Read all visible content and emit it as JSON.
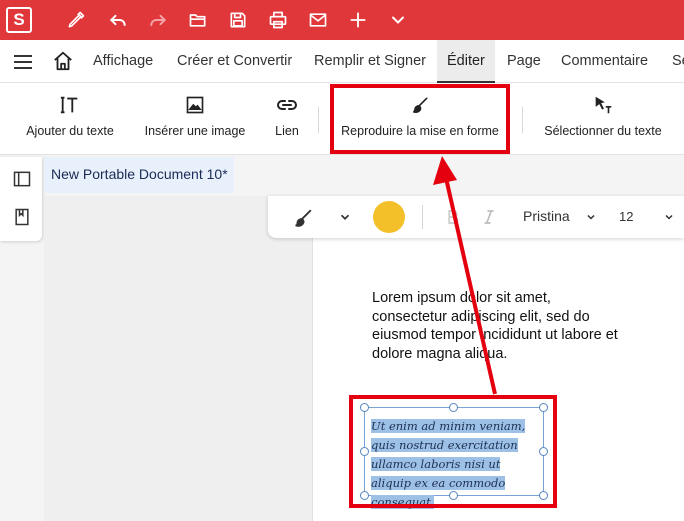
{
  "app": {
    "logo_letter": "S"
  },
  "quick_toolbar": [
    "sign-pen-icon",
    "undo-icon",
    "redo-icon",
    "open-folder-icon",
    "save-icon",
    "print-icon",
    "mail-icon",
    "plus-icon",
    "chevron-down-icon"
  ],
  "menu": {
    "items": [
      {
        "label": "Affichage"
      },
      {
        "label": "Créer et Convertir"
      },
      {
        "label": "Remplir et Signer"
      },
      {
        "label": "Éditer",
        "active": true
      },
      {
        "label": "Page"
      },
      {
        "label": "Commentaire"
      },
      {
        "label": "Se"
      }
    ]
  },
  "ribbon": {
    "add_text": "Ajouter du texte",
    "insert_image": "Insérer une image",
    "link": "Lien",
    "format_painter": "Reproduire la mise en forme",
    "select_text": "Sélectionner du texte"
  },
  "document": {
    "tab_title": "New Portable Document 10*"
  },
  "format_toolbar": {
    "font_name": "Pristina",
    "font_size": "12",
    "text_color": "#f4c02a"
  },
  "page": {
    "paragraph": "Lorem ipsum dolor sit amet, consectetur adipiscing elit, sed do eiusmod tempor incididunt ut labore et dolore magna aliqua.",
    "selected_text": "Ut enim ad minim veniam, quis nostrud exercitation ullamco laboris nisi ut aliquip ex ea commodo consequat."
  },
  "colors": {
    "title_bar": "#e0373b",
    "annotation": "#e4000f",
    "selection": "#9cc0e6"
  }
}
